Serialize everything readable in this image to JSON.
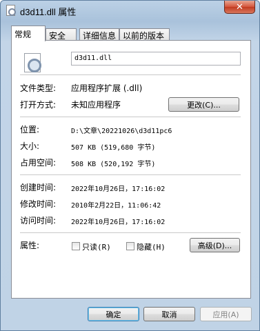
{
  "window": {
    "title": "d3d11.dll 属性",
    "close_glyph": "✕"
  },
  "tabs": [
    {
      "label": "常规",
      "active": true
    },
    {
      "label": "安全",
      "active": false
    },
    {
      "label": "详细信息",
      "active": false
    },
    {
      "label": "以前的版本",
      "active": false
    }
  ],
  "general": {
    "file_name": "d3d11.dll",
    "file_type_label": "文件类型:",
    "file_type_value": "应用程序扩展 (.dll)",
    "opens_with_label": "打开方式:",
    "opens_with_value": "未知应用程序",
    "change_button": "更改(C)...",
    "location_label": "位置:",
    "location_value": "D:\\文章\\20221026\\d3d11pc6",
    "size_label": "大小:",
    "size_value": "507 KB (519,680 字节)",
    "size_on_disk_label": "占用空间:",
    "size_on_disk_value": "508 KB (520,192 字节)",
    "created_label": "创建时间:",
    "created_value": "2022年10月26日，17:16:02",
    "modified_label": "修改时间:",
    "modified_value": "2010年2月22日，11:06:42",
    "accessed_label": "访问时间:",
    "accessed_value": "2022年10月26日，17:16:02",
    "attributes_label": "属性:",
    "readonly_label": "只读(R)",
    "hidden_label": "隐藏(H)",
    "advanced_button": "高级(D)..."
  },
  "footer": {
    "ok_button": "确定",
    "cancel_button": "取消",
    "apply_button": "应用(A)"
  },
  "icons": {
    "title": "dll-file-icon",
    "file": "dll-file-gear-icon"
  }
}
